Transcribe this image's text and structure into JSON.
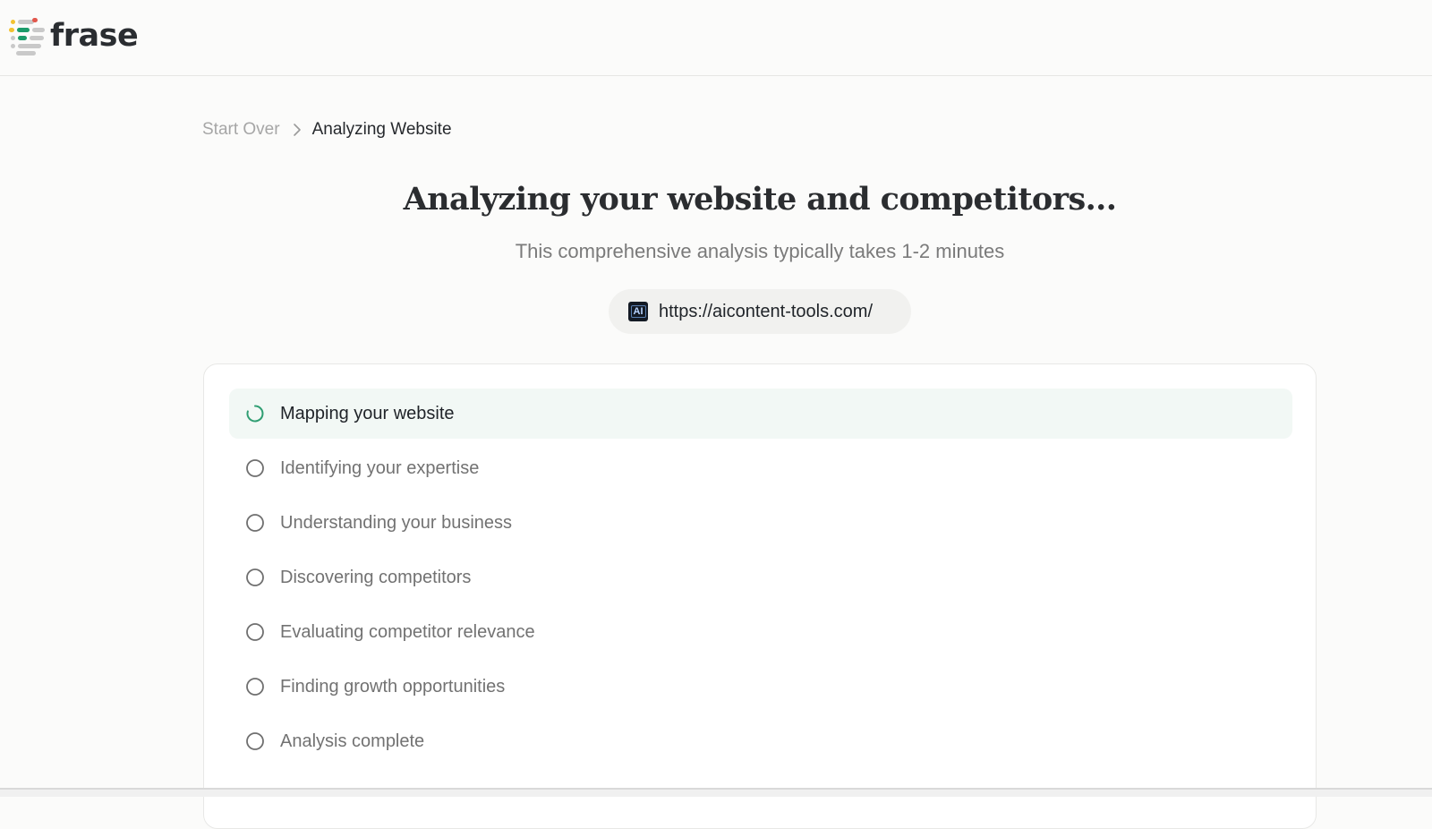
{
  "header": {
    "logo_text": "frase",
    "logo_colors": [
      "#e2574c",
      "#f2c230",
      "#1c9b6a",
      "#c9c9c9"
    ]
  },
  "breadcrumb": {
    "start_over": "Start Over",
    "current": "Analyzing Website"
  },
  "main": {
    "title": "Analyzing your website and competitors...",
    "subtitle": "This comprehensive analysis typically takes 1-2 minutes",
    "url": "https://aicontent-tools.com/",
    "favicon_text": "AI"
  },
  "steps": [
    {
      "label": "Mapping your website",
      "status": "in-progress"
    },
    {
      "label": "Identifying your expertise",
      "status": "pending"
    },
    {
      "label": "Understanding your business",
      "status": "pending"
    },
    {
      "label": "Discovering competitors",
      "status": "pending"
    },
    {
      "label": "Evaluating competitor relevance",
      "status": "pending"
    },
    {
      "label": "Finding growth opportunities",
      "status": "pending"
    },
    {
      "label": "Analysis complete",
      "status": "pending"
    }
  ],
  "colors": {
    "accent_green": "#2f9e72",
    "pending_circle": "#6f6f6f"
  }
}
